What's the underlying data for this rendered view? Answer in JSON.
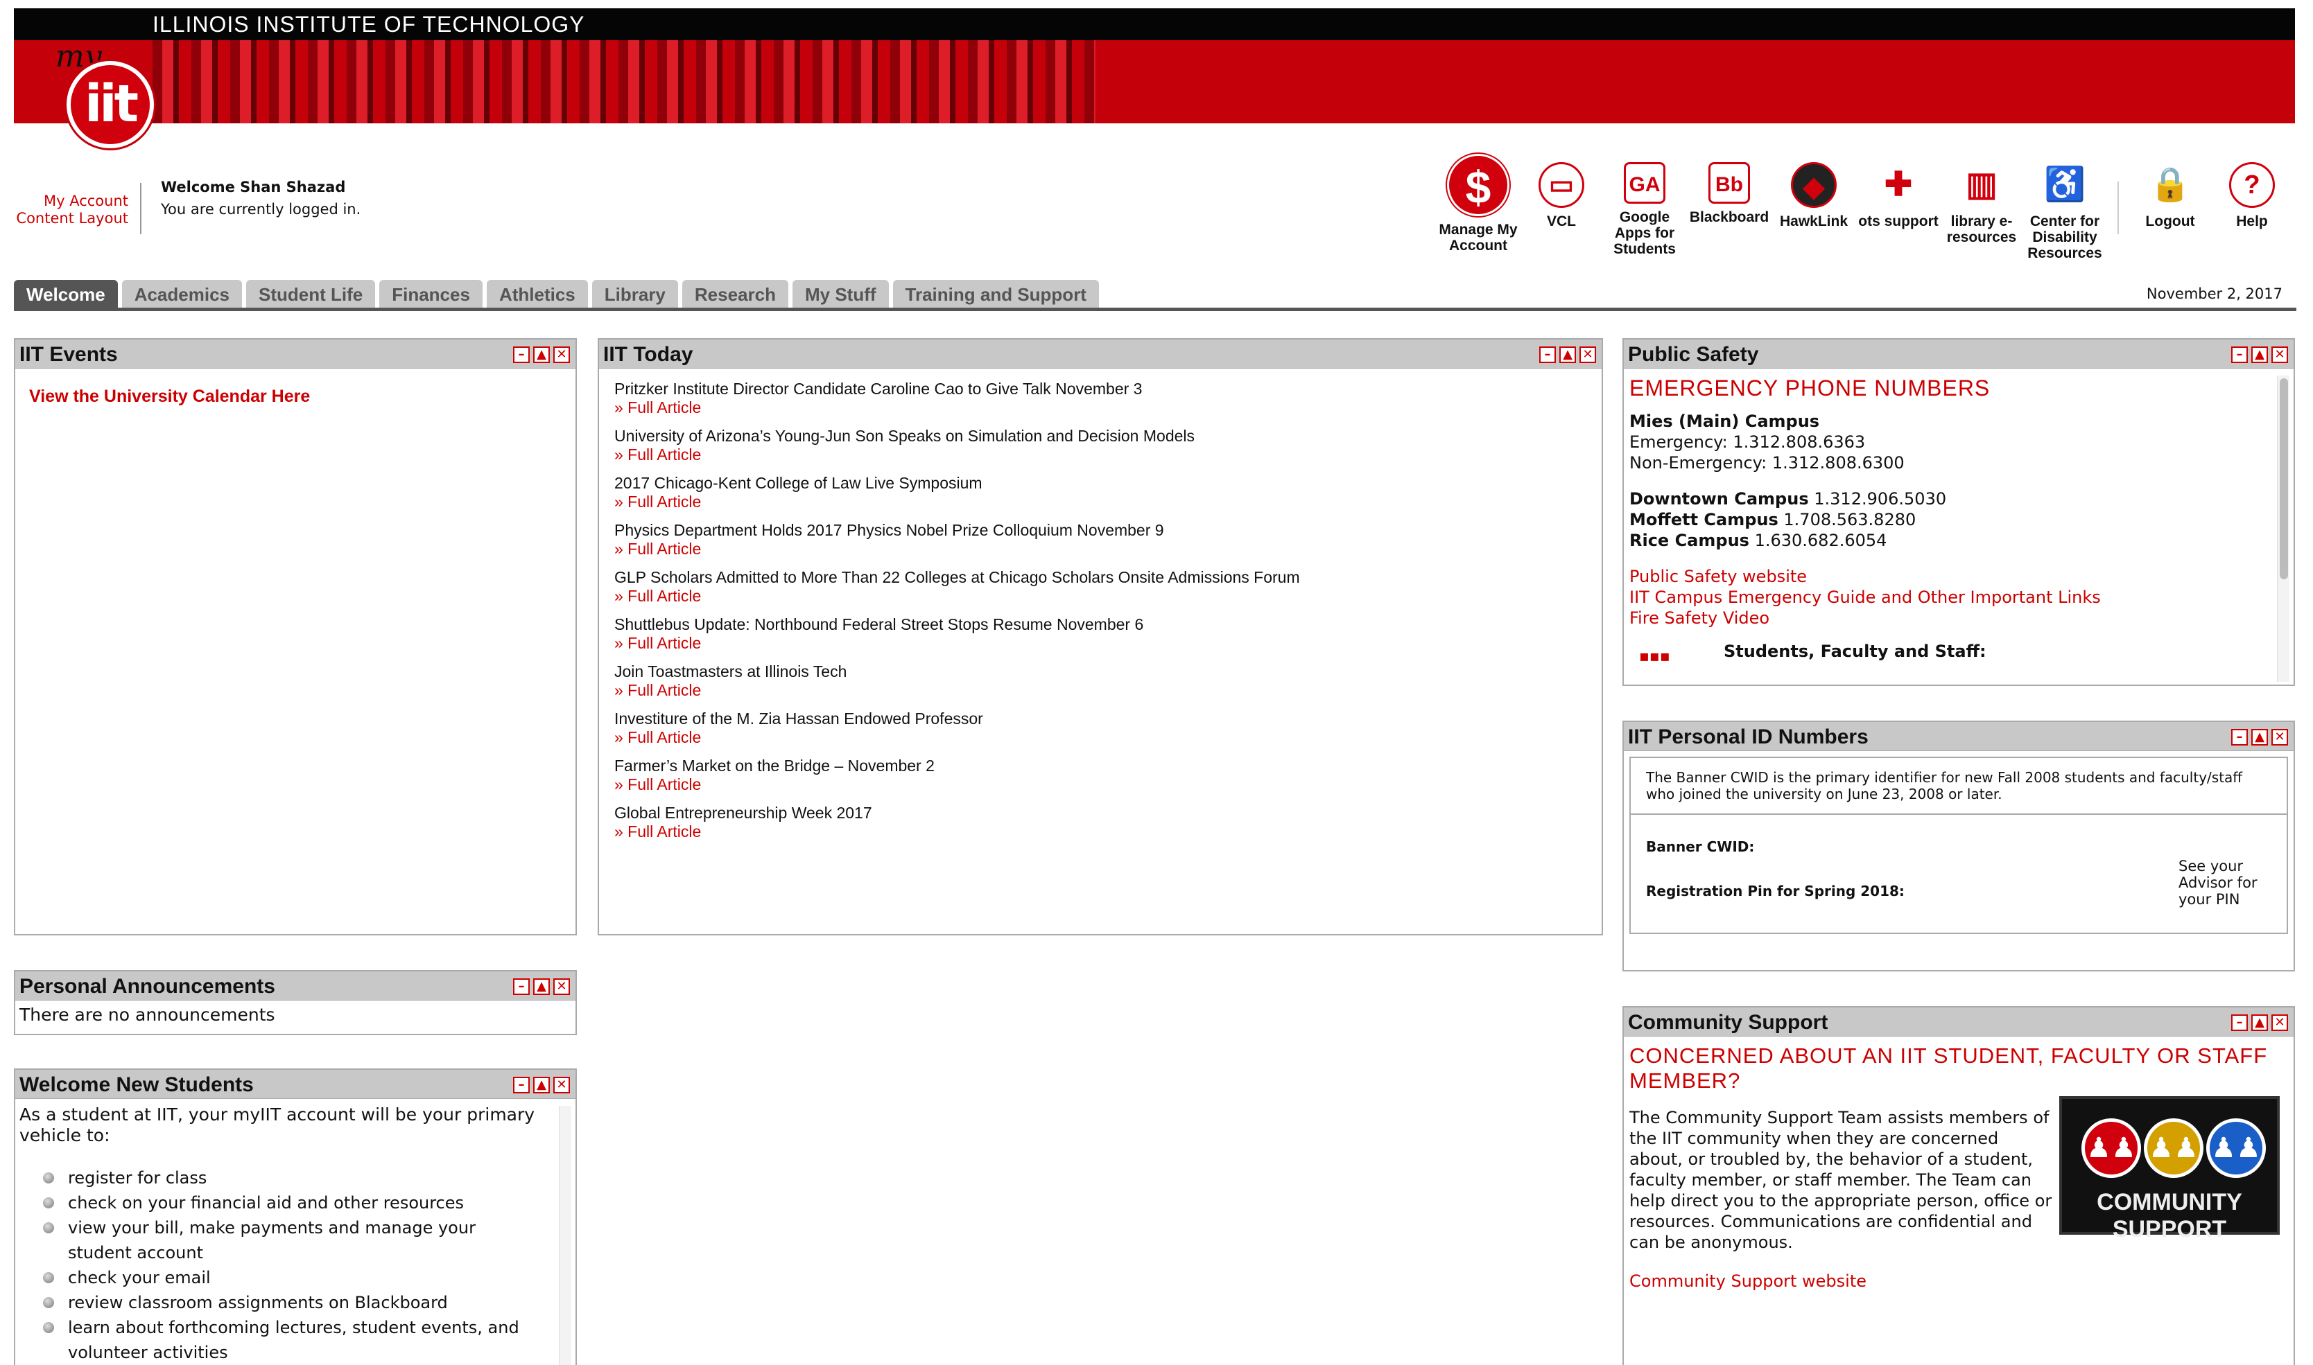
{
  "header": {
    "school": "ILLINOIS INSTITUTE OF TECHNOLOGY",
    "logo_my": "my",
    "logo_iit": "iit"
  },
  "account": {
    "my_account": "My Account",
    "content_layout": "Content Layout",
    "welcome": "Welcome Shan Shazad",
    "status": "You are currently logged in."
  },
  "quick_links": [
    {
      "label": "Manage My Account",
      "icon": "dollar-icon"
    },
    {
      "label": "VCL",
      "icon": "monitor-icon"
    },
    {
      "label": "Google Apps for Students",
      "icon": "google-apps-icon"
    },
    {
      "label": "Blackboard",
      "icon": "blackboard-icon"
    },
    {
      "label": "HawkLink",
      "icon": "hawk-icon"
    },
    {
      "label": "ots support",
      "icon": "plus-icon"
    },
    {
      "label": "library e-resources",
      "icon": "library-icon"
    },
    {
      "label": "Center for Disability Resources",
      "icon": "wheelchair-icon"
    },
    {
      "label": "Logout",
      "icon": "lock-icon"
    },
    {
      "label": "Help",
      "icon": "help-icon"
    }
  ],
  "tabs": [
    "Welcome",
    "Academics",
    "Student Life",
    "Finances",
    "Athletics",
    "Library",
    "Research",
    "My Stuff",
    "Training and Support"
  ],
  "date": "November 2, 2017",
  "events": {
    "title": "IIT Events",
    "calendar_link": "View the University Calendar Here"
  },
  "iit_today": {
    "title": "IIT Today",
    "more_label": "» Full Article",
    "items": [
      "Pritzker Institute Director Candidate Caroline Cao to Give Talk November 3",
      "University of Arizona’s Young-Jun Son Speaks on Simulation and Decision Models",
      "2017 Chicago-Kent College of Law Live Symposium",
      "Physics Department Holds 2017 Physics Nobel Prize Colloquium November 9",
      "GLP Scholars Admitted to More Than 22 Colleges at Chicago Scholars Onsite Admissions Forum",
      "Shuttlebus Update: Northbound Federal Street Stops Resume November 6",
      "Join Toastmasters at Illinois Tech",
      "Investiture of the M. Zia Hassan Endowed Professor",
      "Farmer’s Market on the Bridge – November 2",
      "Global Entrepreneurship Week 2017"
    ]
  },
  "public_safety": {
    "title": "Public Safety",
    "heading": "EMERGENCY PHONE NUMBERS",
    "mies": "Mies (Main) Campus",
    "emergency": "Emergency: 1.312.808.6363",
    "non_emergency": "Non-Emergency: 1.312.808.6300",
    "downtown_label": "Downtown Campus",
    "downtown_num": "1.312.906.5030",
    "moffett_label": "Moffett Campus",
    "moffett_num": "1.708.563.8280",
    "rice_label": "Rice Campus",
    "rice_num": "1.630.682.6054",
    "links": [
      "Public Safety website",
      "IIT Campus Emergency Guide and Other Important Links",
      "Fire Safety Video"
    ],
    "alert_text": "Students, Faculty and Staff:"
  },
  "personal_id": {
    "title": "IIT Personal ID Numbers",
    "intro": "The Banner CWID is the primary identifier for new Fall 2008 students and faculty/staff who joined the university on June 23, 2008 or later.",
    "cwid_label": "Banner CWID:",
    "pin_label": "Registration Pin for Spring 2018:",
    "pin_note": "See your Advisor for your PIN"
  },
  "announcements": {
    "title": "Personal Announcements",
    "text": "There are no announcements"
  },
  "welcome_new": {
    "title": "Welcome New Students",
    "intro": "As a student at IIT, your myIIT account will be your primary vehicle to:",
    "items": [
      "register for class",
      "check on your financial aid and other resources",
      "view your bill, make payments and manage your student account",
      "check your email",
      "review classroom assignments on Blackboard",
      "learn about forthcoming lectures, student events, and volunteer activities"
    ]
  },
  "community": {
    "title": "Community Support",
    "heading": "CONCERNED ABOUT AN IIT STUDENT, FACULTY OR STAFF MEMBER?",
    "text": "The Community Support Team assists members of the IIT community when they are concerned about, or troubled by, the behavior of a student, faculty member, or staff member. The Team can help direct you to the appropriate person, office or resources. Communications are confidential and can be anonymous.",
    "link": "Community Support website",
    "logo_text": "COMMUNITY SUPPORT"
  },
  "colors": {
    "accent": "#cc0000",
    "tab_active": "#555555",
    "header_bg": "#c8c8c8"
  }
}
